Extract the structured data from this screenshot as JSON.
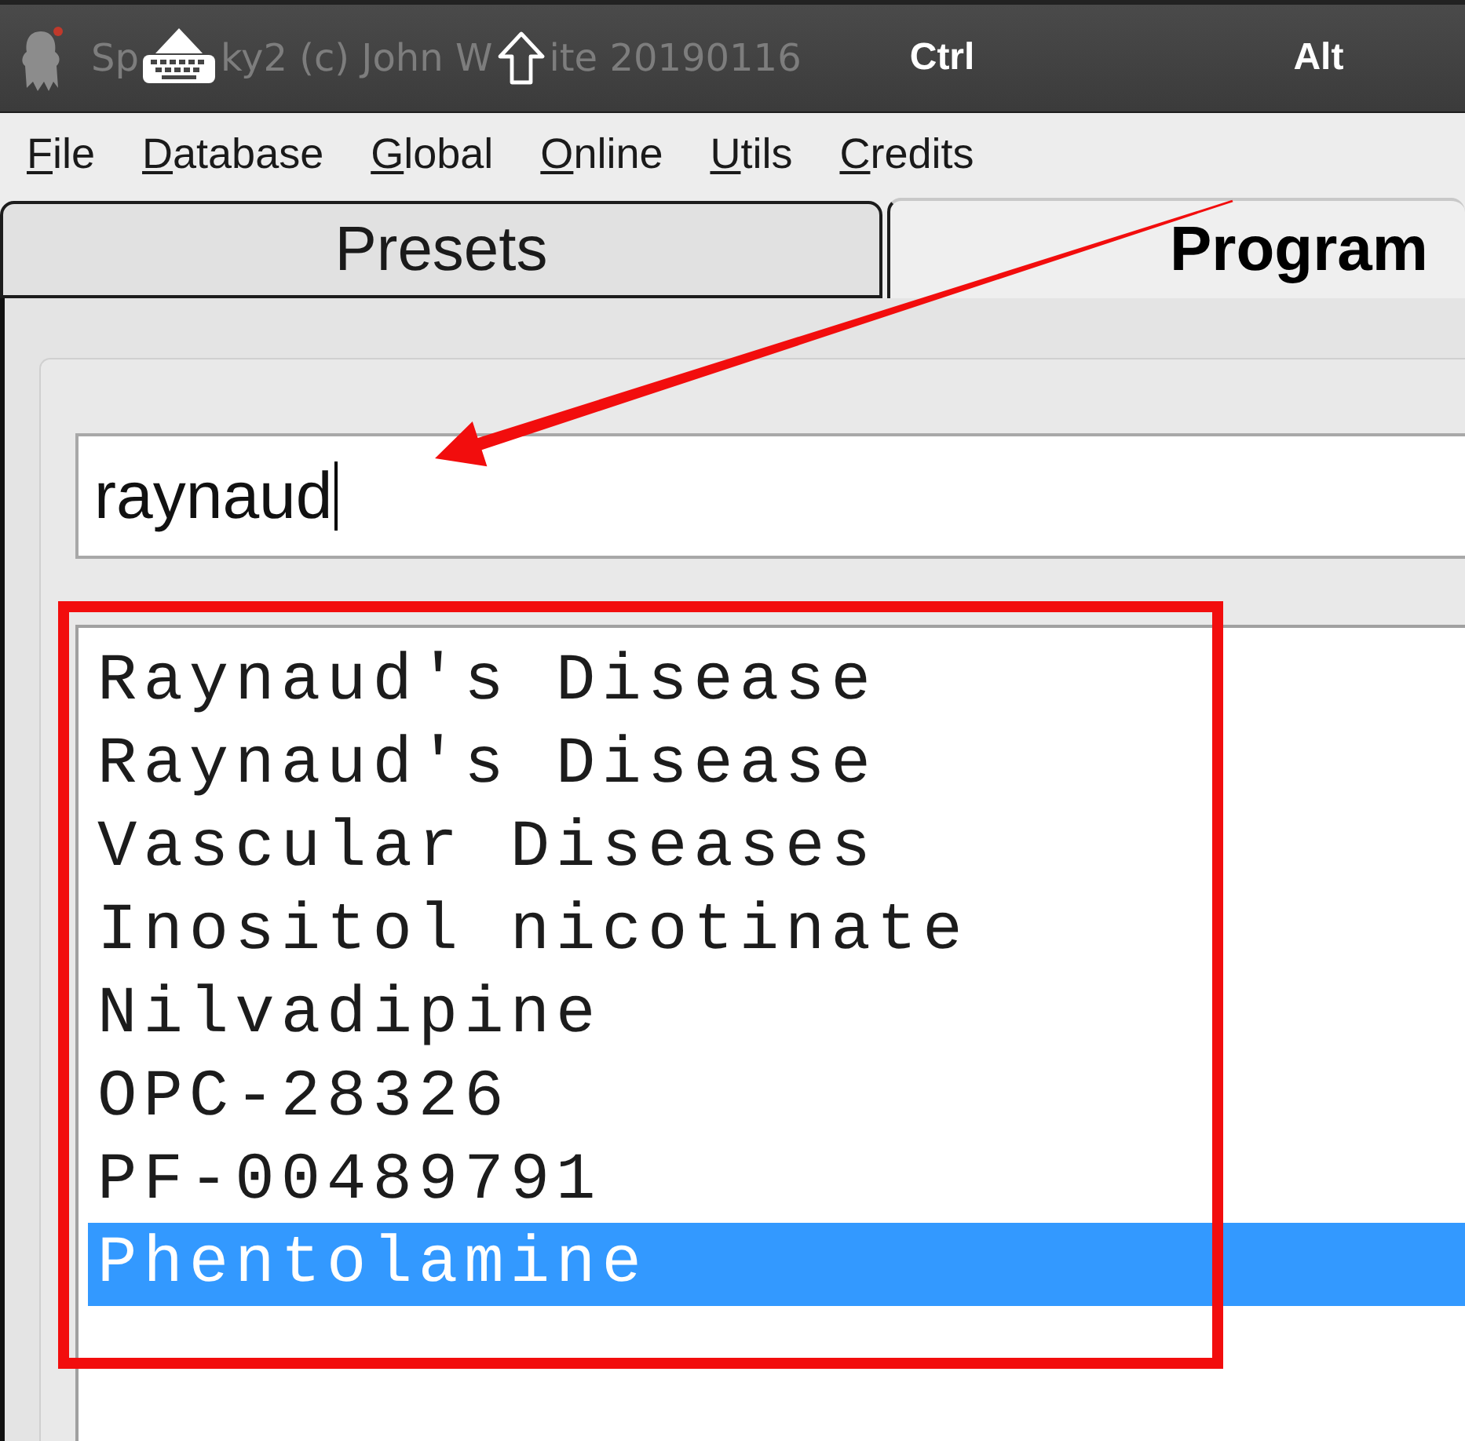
{
  "title_bar": {
    "segments": [
      {
        "kind": "title",
        "text": "Sp"
      },
      {
        "kind": "keyboard"
      },
      {
        "kind": "title",
        "text": "ky2 (c) John W"
      },
      {
        "kind": "shift"
      },
      {
        "kind": "title",
        "text": "ite 20190116"
      },
      {
        "kind": "key",
        "label": "Ctrl"
      },
      {
        "kind": "key",
        "label": "Alt"
      }
    ]
  },
  "menu": [
    "File",
    "Database",
    "Global",
    "Online",
    "Utils",
    "Credits"
  ],
  "tabs": [
    {
      "label": "Presets",
      "selected": false
    },
    {
      "label": "Program",
      "selected": true
    }
  ],
  "search": {
    "value": "raynaud",
    "focused": true
  },
  "results": [
    {
      "label": "Raynaud's Disease",
      "selected": false
    },
    {
      "label": "Raynaud's Disease",
      "selected": false
    },
    {
      "label": "Vascular Diseases",
      "selected": false
    },
    {
      "label": "Inositol nicotinate",
      "selected": false
    },
    {
      "label": "Nilvadipine",
      "selected": false
    },
    {
      "label": "OPC-28326",
      "selected": false
    },
    {
      "label": "PF-00489791",
      "selected": false
    },
    {
      "label": "Phentolamine",
      "selected": true
    }
  ]
}
